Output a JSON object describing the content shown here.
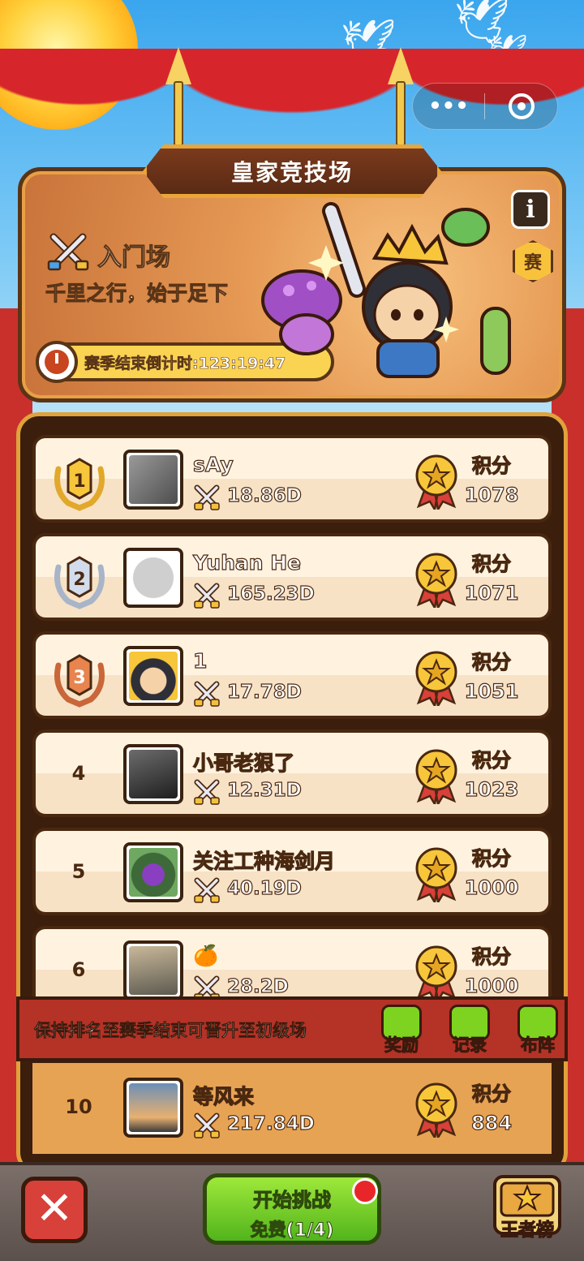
{
  "capsule": {
    "more_label": "•••"
  },
  "header": {
    "title": "皇家竞技场",
    "arena_name": "入门场",
    "motto": "千里之行，始于足下",
    "countdown": "赛季结束倒计时:123:19:47",
    "info_label": "i",
    "season_label": "赛"
  },
  "leaderboard": {
    "score_label": "积分",
    "rows": [
      {
        "rank": "1",
        "name": "sAy",
        "power": "18.86D",
        "score": "1078"
      },
      {
        "rank": "2",
        "name": "Yuhan He",
        "power": "165.23D",
        "score": "1071"
      },
      {
        "rank": "3",
        "name": "1",
        "power": "17.78D",
        "score": "1051"
      },
      {
        "rank": "4",
        "name": "小哥老狠了",
        "power": "12.31D",
        "score": "1023"
      },
      {
        "rank": "5",
        "name": "关注工种海剑月",
        "power": "40.19D",
        "score": "1000"
      },
      {
        "rank": "6",
        "name": "🍊",
        "power": "28.2D",
        "score": "1000"
      }
    ],
    "own": {
      "rank": "10",
      "name": "等风来",
      "power": "217.84D",
      "score": "884"
    }
  },
  "promo": {
    "text": "保持排名至赛季结束可晋升至初级场",
    "buttons": [
      "奖励",
      "记录",
      "布阵"
    ]
  },
  "bottom": {
    "start_label": "开始挑战",
    "start_sub": "免费(1/4)",
    "king_label": "王者榜",
    "close_label": "✕"
  },
  "colors": {
    "gold": "#f4c04c",
    "green": "#7ed321",
    "red": "#d8403a",
    "frame": "#3b1e0c"
  }
}
